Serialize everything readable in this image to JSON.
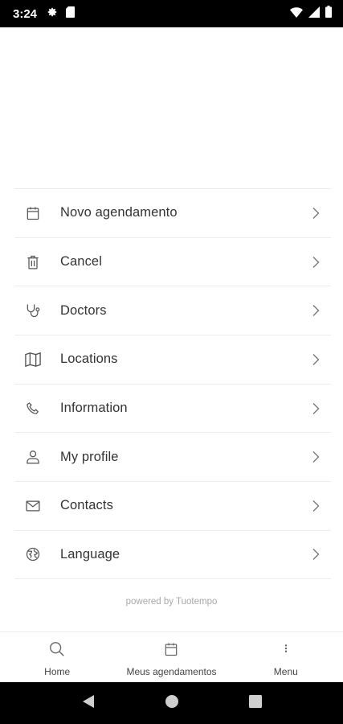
{
  "status_bar": {
    "time": "3:24",
    "icons": [
      "gear-icon",
      "sim-card-icon",
      "wifi-icon",
      "signal-icon",
      "battery-icon"
    ]
  },
  "menu": {
    "items": [
      {
        "label": "Novo agendamento",
        "icon": "calendar-icon"
      },
      {
        "label": "Cancel",
        "icon": "trash-icon"
      },
      {
        "label": "Doctors",
        "icon": "stethoscope-icon"
      },
      {
        "label": "Locations",
        "icon": "map-icon"
      },
      {
        "label": "Information",
        "icon": "phone-icon"
      },
      {
        "label": "My profile",
        "icon": "user-icon"
      },
      {
        "label": "Contacts",
        "icon": "envelope-icon"
      },
      {
        "label": "Language",
        "icon": "language-icon"
      }
    ]
  },
  "footer": {
    "powered_by": "powered by Tuotempo"
  },
  "bottom_nav": {
    "items": [
      {
        "label": "Home",
        "icon": "search-icon"
      },
      {
        "label": "Meus agendamentos",
        "icon": "calendar-icon"
      },
      {
        "label": "Menu",
        "icon": "more-vertical-icon"
      }
    ]
  },
  "colors": {
    "text": "#333333",
    "divider": "#ececec",
    "muted": "#a8a8a8",
    "system_bar": "#000000"
  }
}
